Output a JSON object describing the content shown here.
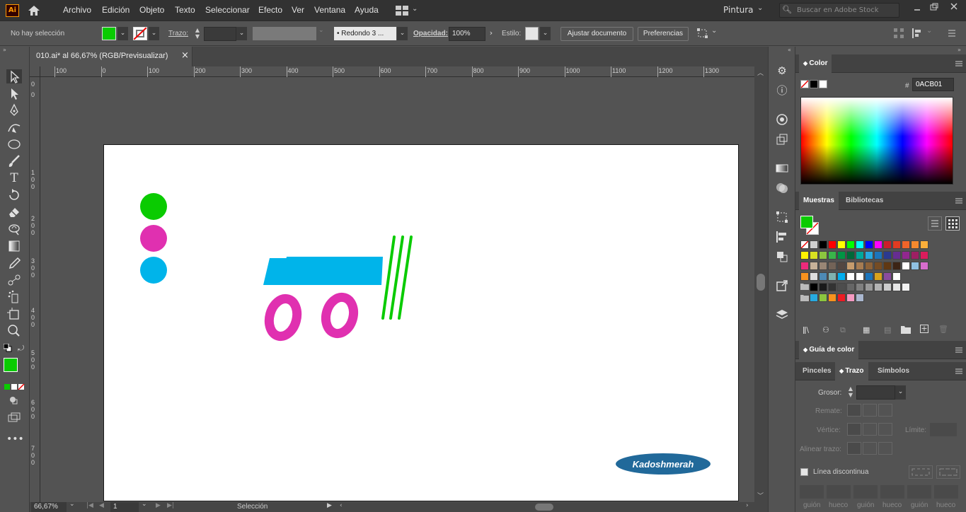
{
  "app": {
    "logo": "Ai",
    "workspace": "Pintura",
    "search_placeholder": "Buscar en Adobe Stock"
  },
  "menu": [
    "Archivo",
    "Edición",
    "Objeto",
    "Texto",
    "Seleccionar",
    "Efecto",
    "Ver",
    "Ventana",
    "Ayuda"
  ],
  "control": {
    "selection": "No hay selección",
    "stroke_label": "Trazo:",
    "brush": "Redondo 3 ...",
    "opacity_label": "Opacidad:",
    "opacity_value": "100%",
    "style_label": "Estilo:",
    "fit_button": "Ajustar documento",
    "prefs_button": "Preferencias",
    "fill_color": "#0ACB01"
  },
  "document": {
    "tab_title": "010.ai* al 66,67% (RGB/Previsualizar)",
    "close": "×"
  },
  "ruler": {
    "h_ticks": [
      "100",
      "0",
      "100",
      "200",
      "300",
      "400",
      "500",
      "600",
      "700",
      "800",
      "900",
      "1000",
      "1100",
      "1200",
      "1300"
    ],
    "v_ticks": [
      "0",
      "0",
      "100",
      "200",
      "300",
      "400",
      "500",
      "600",
      "700"
    ]
  },
  "artwork": {
    "circle_colors": [
      "#0ACB01",
      "#E030B0",
      "#00B4EA"
    ],
    "tab_color": "#00B4EA",
    "ring_color": "#E030B0",
    "line_color": "#0ACB01",
    "badge_text": "Kadoshmerah",
    "badge_color": "#21699A"
  },
  "status": {
    "zoom": "66,67%",
    "page": "1",
    "mode": "Selección"
  },
  "color_panel": {
    "title": "Color",
    "hex_label": "#",
    "hex_value": "0ACB01"
  },
  "swatches_panel": {
    "tabs": [
      "Muestras",
      "Bibliotecas"
    ],
    "rows": [
      [
        "#ffffff",
        "#d0d0d0",
        "#000000",
        "#ff0000",
        "#ffff00",
        "#00ff00",
        "#00ffff",
        "#0000ff",
        "#ff00ff",
        "#cc1e2b",
        "#e23b22",
        "#f0642a",
        "#f5892e",
        "#fbaf3a"
      ],
      [
        "#fff200",
        "#d7e021",
        "#8cc63f",
        "#39b54a",
        "#009444",
        "#006838",
        "#00a99d",
        "#27aae1",
        "#1c75bc",
        "#2b3990",
        "#662d91",
        "#92278f",
        "#9e1f63",
        "#da1c5c"
      ],
      [
        "#ee2a7b",
        "#c7b299",
        "#998675",
        "#736357",
        "#534741",
        "#c69c6d",
        "#a67c52",
        "#8c6239",
        "#754c24",
        "#603813",
        "#3c2415",
        "#ffffff",
        "#8fc1e3",
        "#d86dcd"
      ],
      [
        "#f7931e",
        "#dddddd",
        "#4d8ab5",
        "#7fb2b0",
        "#00aeef",
        "#ffffff",
        "#ffffff",
        "#1b75bc",
        "#d8a31d",
        "#8a4c9e",
        "#ffffff"
      ],
      [
        "#000000",
        "#1a1a1a",
        "#333333",
        "#4d4d4d",
        "#666666",
        "#808080",
        "#999999",
        "#b3b3b3",
        "#cccccc",
        "#e6e6e6",
        "#f2f2f2"
      ],
      [
        "#27aae1",
        "#8cc63f",
        "#f7931e",
        "#ed1c24",
        "#f49ac2",
        "#aab7cf"
      ]
    ]
  },
  "guide_panel": {
    "title": "Guía de color"
  },
  "stroke_panel": {
    "tabs": [
      "Pinceles",
      "Trazo",
      "Símbolos"
    ],
    "weight_label": "Grosor:",
    "cap_label": "Remate:",
    "corner_label": "Vértice:",
    "limit_label": "Límite:",
    "align_label": "Alinear trazo:",
    "dashed_label": "Línea discontinua",
    "dash_labels": [
      "guión",
      "hueco",
      "guión",
      "hueco",
      "guión",
      "hueco"
    ]
  }
}
